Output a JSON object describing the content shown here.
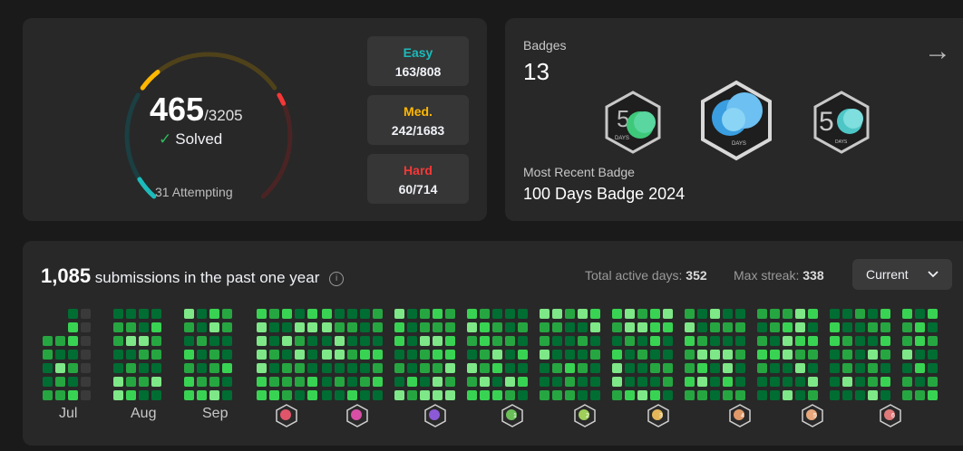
{
  "solved": {
    "count": "465",
    "total": "/3205",
    "label": "Solved",
    "attempting": "31 Attempting",
    "easy": {
      "label": "Easy",
      "value": "163/808",
      "color": "#1cbaba",
      "fraction": 0.2017
    },
    "medium": {
      "label": "Med.",
      "value": "242/1683",
      "color": "#ffb700",
      "fraction": 0.1438
    },
    "hard": {
      "label": "Hard",
      "value": "60/714",
      "color": "#f63737",
      "fraction": 0.084
    }
  },
  "badges": {
    "title": "Badges",
    "count": "13",
    "recent_label": "Most Recent Badge",
    "recent_name": "100 Days Badge 2024",
    "items": [
      {
        "icon": "50-days-badge-green-icon",
        "text": "DAYS"
      },
      {
        "icon": "100-days-badge-blue-icon",
        "text": "DAYS"
      },
      {
        "icon": "50-days-badge-teal-icon",
        "text": "DAYS"
      }
    ]
  },
  "heatmap": {
    "count": "1,085",
    "title_rest": "submissions in the past one year",
    "active_label": "Total active days:",
    "active_value": "352",
    "streak_label": "Max streak:",
    "streak_value": "338",
    "dropdown": "Current",
    "months": [
      "Jul",
      "Aug",
      "Sep"
    ],
    "month_badges": [
      {
        "icon": "monthly-badge-red-icon",
        "color": "#e0556a"
      },
      {
        "icon": "monthly-badge-pink-icon",
        "color": "#d94fa6"
      },
      {
        "icon": "monthly-badge-purple-icon",
        "color": "#8c5ad6"
      },
      {
        "icon": "monthly-badge-green-icon",
        "color": "#6abf59",
        "text": "1"
      },
      {
        "icon": "monthly-badge-lime-icon",
        "color": "#9fcf5a",
        "text": "2"
      },
      {
        "icon": "monthly-badge-gold-icon",
        "color": "#e3b65a",
        "text": "3"
      },
      {
        "icon": "monthly-badge-orange-icon",
        "color": "#e09a6a",
        "text": "4"
      },
      {
        "icon": "monthly-badge-peach-icon",
        "color": "#e8a87c",
        "text": "5"
      },
      {
        "icon": "monthly-badge-rose-icon",
        "color": "#e07a7a",
        "text": "6"
      }
    ]
  }
}
